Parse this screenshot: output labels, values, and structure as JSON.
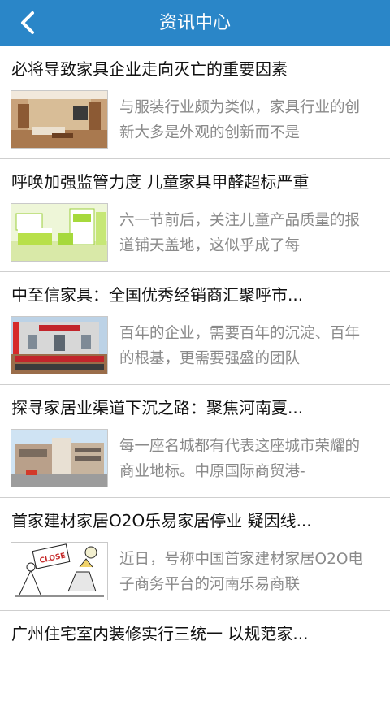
{
  "header": {
    "title": "资讯中心",
    "back_icon": "chevron-left-icon"
  },
  "colors": {
    "header_bg": "#2a86c8",
    "summary_text": "#8a8a8a"
  },
  "articles": [
    {
      "title": "必将导致家具企业走向灭亡的重要因素",
      "summary": "与服装行业颇为类似，家具行业的创新大多是外观的创新而不是",
      "image": "living-room-thumbnail"
    },
    {
      "title": "呼唤加强监管力度 儿童家具甲醛超标严重",
      "summary": "六一节前后，关注儿童产品质量的报道铺天盖地，这似乎成了每",
      "image": "kids-bedroom-thumbnail"
    },
    {
      "title": "中至信家具：全国优秀经销商汇聚呼市...",
      "summary": "百年的企业，需要百年的沉淀、百年的根基，更需要强盛的团队",
      "image": "dealer-meeting-thumbnail"
    },
    {
      "title": "探寻家居业渠道下沉之路：聚焦河南夏...",
      "summary": "每一座名城都有代表这座城市荣耀的商业地标。中原国际商贸港-",
      "image": "commercial-building-thumbnail"
    },
    {
      "title": "首家建材家居O2O乐易家居停业 疑因线...",
      "summary": "近日，号称中国首家建材家居O2O电子商务平台的河南乐易商联",
      "image": "closed-store-cartoon-thumbnail",
      "image_text": "CLOSE"
    },
    {
      "title": "广州住宅室内装修实行三统一 以规范家...",
      "summary": "",
      "image": ""
    }
  ]
}
